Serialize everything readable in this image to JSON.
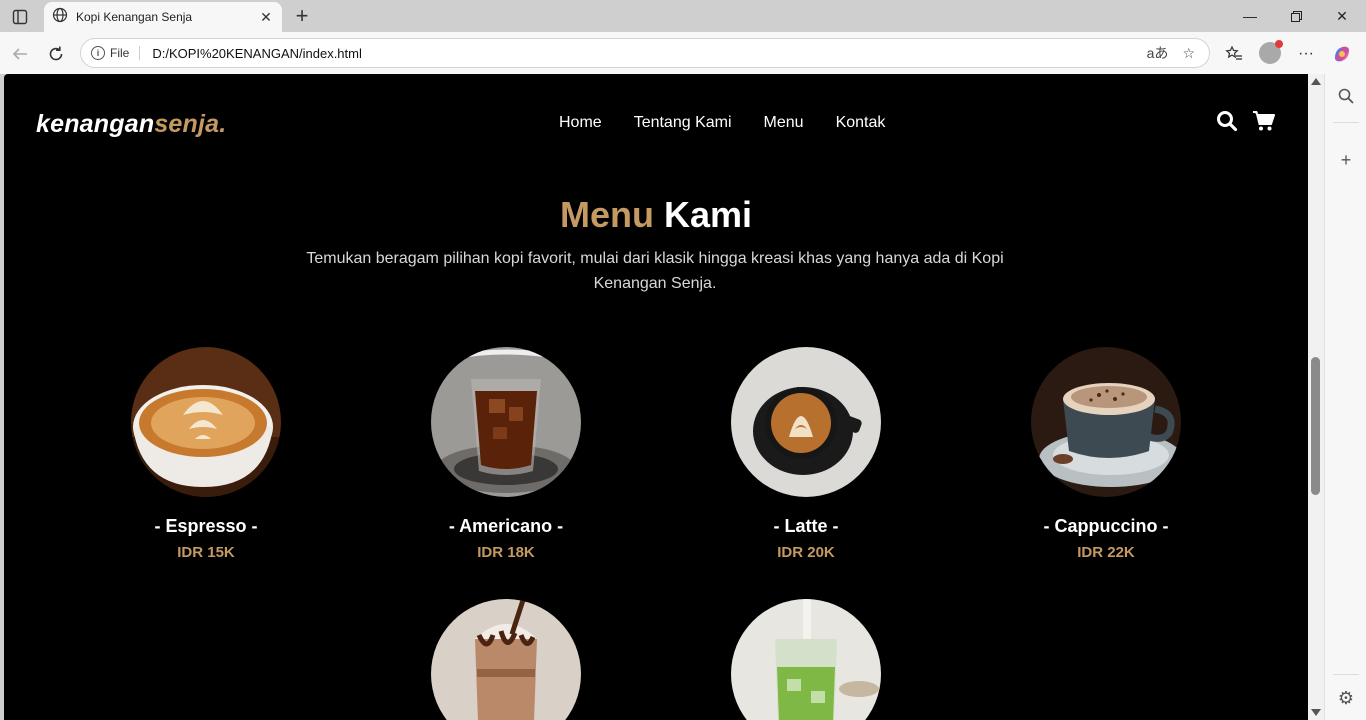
{
  "browser": {
    "tab_title": "Kopi Kenangan Senja",
    "address_label": "File",
    "url": "D:/KOPI%20KENANGAN/index.html"
  },
  "site": {
    "logo_main": "kenangan",
    "logo_accent": "senja.",
    "nav": [
      "Home",
      "Tentang Kami",
      "Menu",
      "Kontak"
    ],
    "heading_accent": "Menu",
    "heading_main": "Kami",
    "subtitle": "Temukan beragam pilihan kopi favorit, mulai dari klasik hingga kreasi khas yang hanya ada di Kopi Kenangan Senja.",
    "menu_items": [
      {
        "name": "- Espresso -",
        "price": "IDR 15K"
      },
      {
        "name": "- Americano -",
        "price": "IDR 18K"
      },
      {
        "name": "- Latte -",
        "price": "IDR 20K"
      },
      {
        "name": "- Cappuccino -",
        "price": "IDR 22K"
      }
    ]
  },
  "colors": {
    "accent": "#c49a62",
    "page_bg": "#000000"
  },
  "icons": [
    "sidebar-toggle-icon",
    "globe-icon",
    "close-icon",
    "plus-icon",
    "back-icon",
    "reload-icon",
    "read-aloud-icon",
    "star-icon",
    "favorites-icon",
    "more-icon",
    "copilot-icon",
    "search-icon",
    "cart-icon",
    "settings-icon"
  ]
}
